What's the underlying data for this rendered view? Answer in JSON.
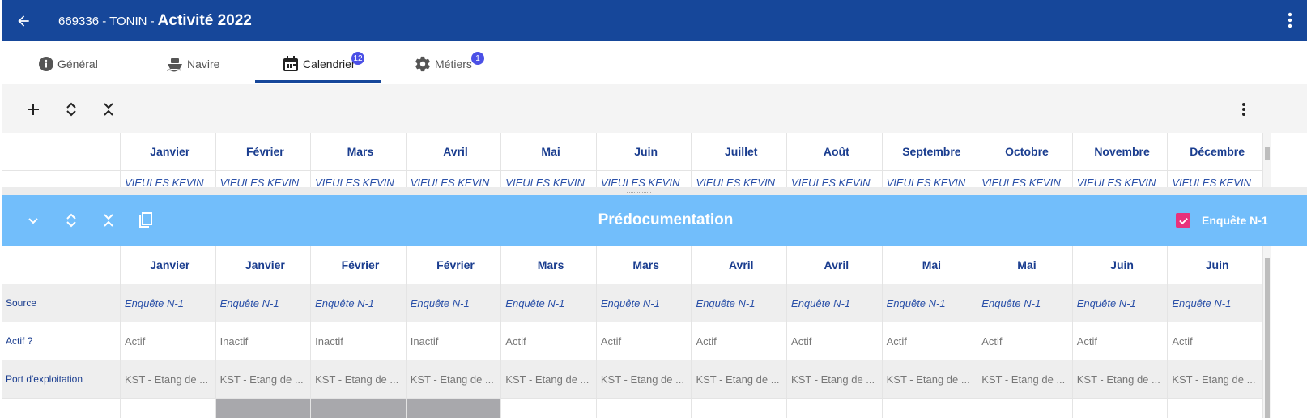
{
  "header": {
    "record_prefix": "669336 - TONIN -",
    "title": "Activité 2022"
  },
  "tabs": [
    {
      "label": "Général",
      "icon": "info-icon",
      "badge": ""
    },
    {
      "label": "Navire",
      "icon": "ship-icon",
      "badge": ""
    },
    {
      "label": "Calendrier",
      "icon": "calendar-icon",
      "badge": "12"
    },
    {
      "label": "Métiers",
      "icon": "gear-icon",
      "badge": "1"
    }
  ],
  "calendar_grid": {
    "months": [
      "Janvier",
      "Février",
      "Mars",
      "Avril",
      "Mai",
      "Juin",
      "Juillet",
      "Août",
      "Septembre",
      "Octobre",
      "Novembre",
      "Décembre"
    ],
    "row_partial": "VIEULES KEVIN"
  },
  "predoc": {
    "title": "Prédocumentation",
    "checkbox_label": "Enquête N-1",
    "checkbox_checked": true,
    "months": [
      "Janvier",
      "Janvier",
      "Février",
      "Février",
      "Mars",
      "Mars",
      "Avril",
      "Avril",
      "Mai",
      "Mai",
      "Juin",
      "Juin"
    ],
    "rows": [
      {
        "label": "Source",
        "values": [
          "Enquête N-1",
          "Enquête N-1",
          "Enquête N-1",
          "Enquête N-1",
          "Enquête N-1",
          "Enquête N-1",
          "Enquête N-1",
          "Enquête N-1",
          "Enquête N-1",
          "Enquête N-1",
          "Enquête N-1",
          "Enquête N-1"
        ]
      },
      {
        "label": "Actif ?",
        "values": [
          "Actif",
          "Inactif",
          "Inactif",
          "Inactif",
          "Actif",
          "Actif",
          "Actif",
          "Actif",
          "Actif",
          "Actif",
          "Actif",
          "Actif"
        ]
      },
      {
        "label": "Port d'exploitation",
        "values": [
          "KST - Etang de ...",
          "KST - Etang de ...",
          "KST - Etang de ...",
          "KST - Etang de ...",
          "KST - Etang de ...",
          "KST - Etang de ...",
          "KST - Etang de ...",
          "KST - Etang de ...",
          "KST - Etang de ...",
          "KST - Etang de ...",
          "KST - Etang de ...",
          "KST - Etang de ..."
        ]
      }
    ]
  },
  "colors": {
    "header": "#16479a",
    "panel": "#72befb",
    "checkbox": "#e8317c",
    "badge": "#4b50e6"
  }
}
